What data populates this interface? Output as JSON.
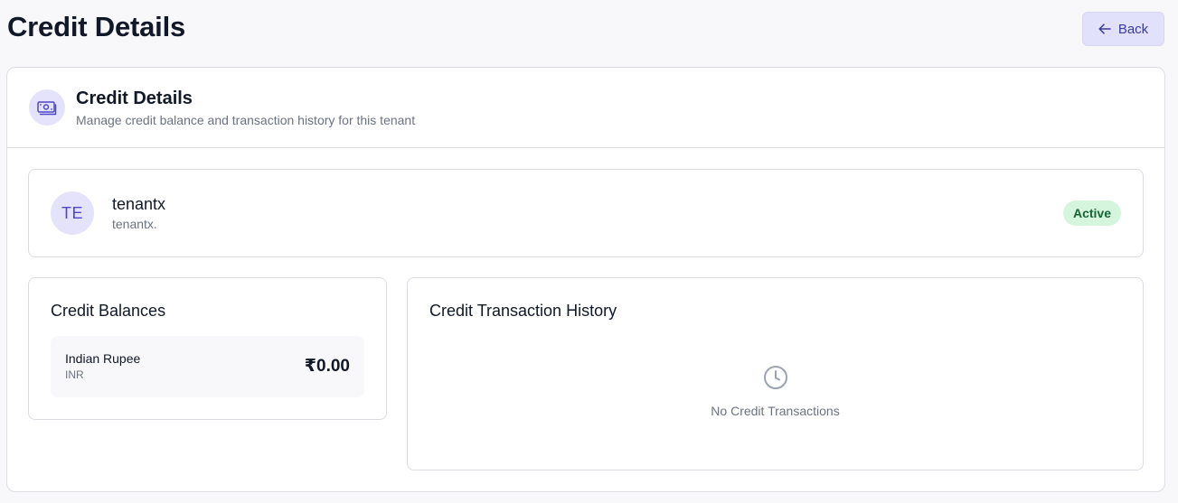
{
  "page": {
    "title": "Credit Details",
    "back_label": "Back"
  },
  "card": {
    "title": "Credit Details",
    "subtitle": "Manage credit balance and transaction history for this tenant",
    "icon": "banknote-icon"
  },
  "tenant": {
    "initials": "TE",
    "name": "tenantx",
    "subtitle": "tenantx.",
    "status": "Active"
  },
  "balances": {
    "title": "Credit Balances",
    "items": [
      {
        "currency_name": "Indian Rupee",
        "currency_code": "INR",
        "amount": "₹0.00"
      }
    ]
  },
  "history": {
    "title": "Credit Transaction History",
    "empty_icon": "clock-icon",
    "empty_text": "No Credit Transactions"
  },
  "colors": {
    "accent": "#4f46c9",
    "accent_bg": "#e4e3fb",
    "status_bg": "#d6f5dd",
    "status_text": "#166534"
  }
}
